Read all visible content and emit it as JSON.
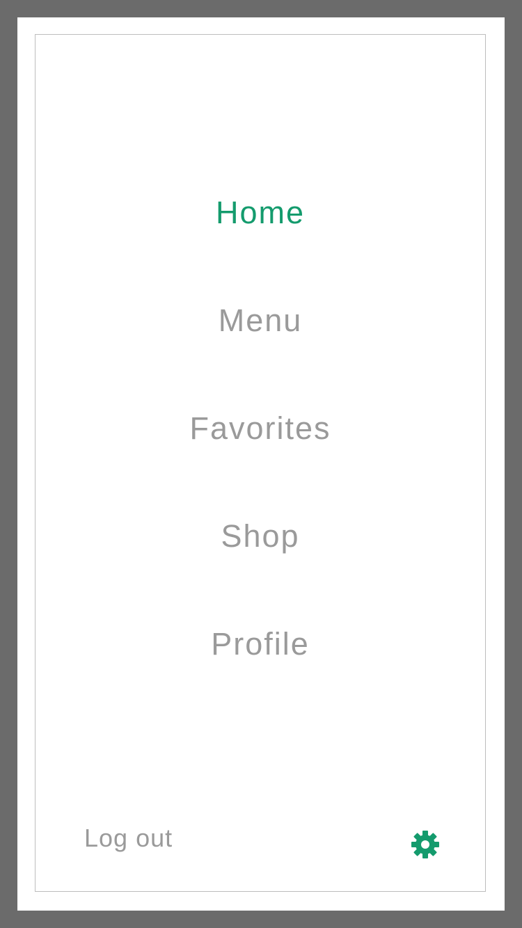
{
  "menu": {
    "items": [
      {
        "label": "Home",
        "active": true
      },
      {
        "label": "Menu",
        "active": false
      },
      {
        "label": "Favorites",
        "active": false
      },
      {
        "label": "Shop",
        "active": false
      },
      {
        "label": "Profile",
        "active": false
      }
    ]
  },
  "footer": {
    "logout_label": "Log out",
    "settings_icon": "gear-icon"
  },
  "colors": {
    "accent": "#149b6d",
    "inactive_text": "#9a9a9a",
    "outer_background": "#6b6b6b",
    "panel_border": "#bdbdbd"
  }
}
